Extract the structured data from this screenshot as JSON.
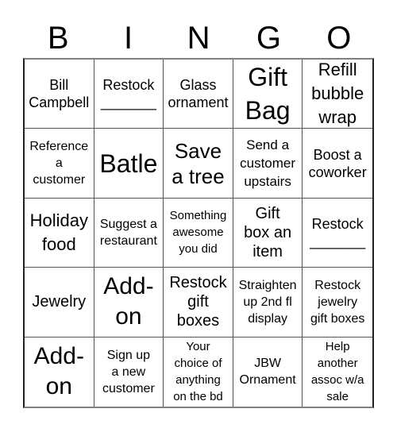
{
  "header": [
    "B",
    "I",
    "N",
    "G",
    "O"
  ],
  "cells": [
    {
      "text": "Bill\nCampbell",
      "size": "s18"
    },
    {
      "text": "Restock\n_______",
      "size": "s18"
    },
    {
      "text": "Glass\nornament",
      "size": "s18"
    },
    {
      "text": "Gift\nBag",
      "size": "s32"
    },
    {
      "text": "Refill\nbubble\nwrap",
      "size": "s22"
    },
    {
      "text": "Reference\na\ncustomer",
      "size": "s16"
    },
    {
      "text": "Batle",
      "size": "s32"
    },
    {
      "text": "Save\na tree",
      "size": "s26"
    },
    {
      "text": "Send a\ncustomer\nupstairs",
      "size": "s17"
    },
    {
      "text": "Boost a\ncoworker",
      "size": "s18"
    },
    {
      "text": "Holiday\nfood",
      "size": "s22"
    },
    {
      "text": "Suggest a\nrestaurant",
      "size": "s16"
    },
    {
      "text": "Something\nawesome\nyou did",
      "size": "s15"
    },
    {
      "text": "Gift\nbox an\nitem",
      "size": "s20"
    },
    {
      "text": "Restock\n_______",
      "size": "s18"
    },
    {
      "text": "Jewelry",
      "size": "s20"
    },
    {
      "text": "Add-\non",
      "size": "s30"
    },
    {
      "text": "Restock\ngift\nboxes",
      "size": "s20"
    },
    {
      "text": "Straighten\nup 2nd fl\ndisplay",
      "size": "s16"
    },
    {
      "text": "Restock\njewelry\ngift boxes",
      "size": "s16"
    },
    {
      "text": "Add-\non",
      "size": "s30"
    },
    {
      "text": "Sign up\na new\ncustomer",
      "size": "s16"
    },
    {
      "text": "Your\nchoice of\nanything\non the bd",
      "size": "s15"
    },
    {
      "text": "JBW\nOrnament",
      "size": "s16"
    },
    {
      "text": "Help\nanother\nassoc w/a\nsale",
      "size": "s15"
    }
  ]
}
